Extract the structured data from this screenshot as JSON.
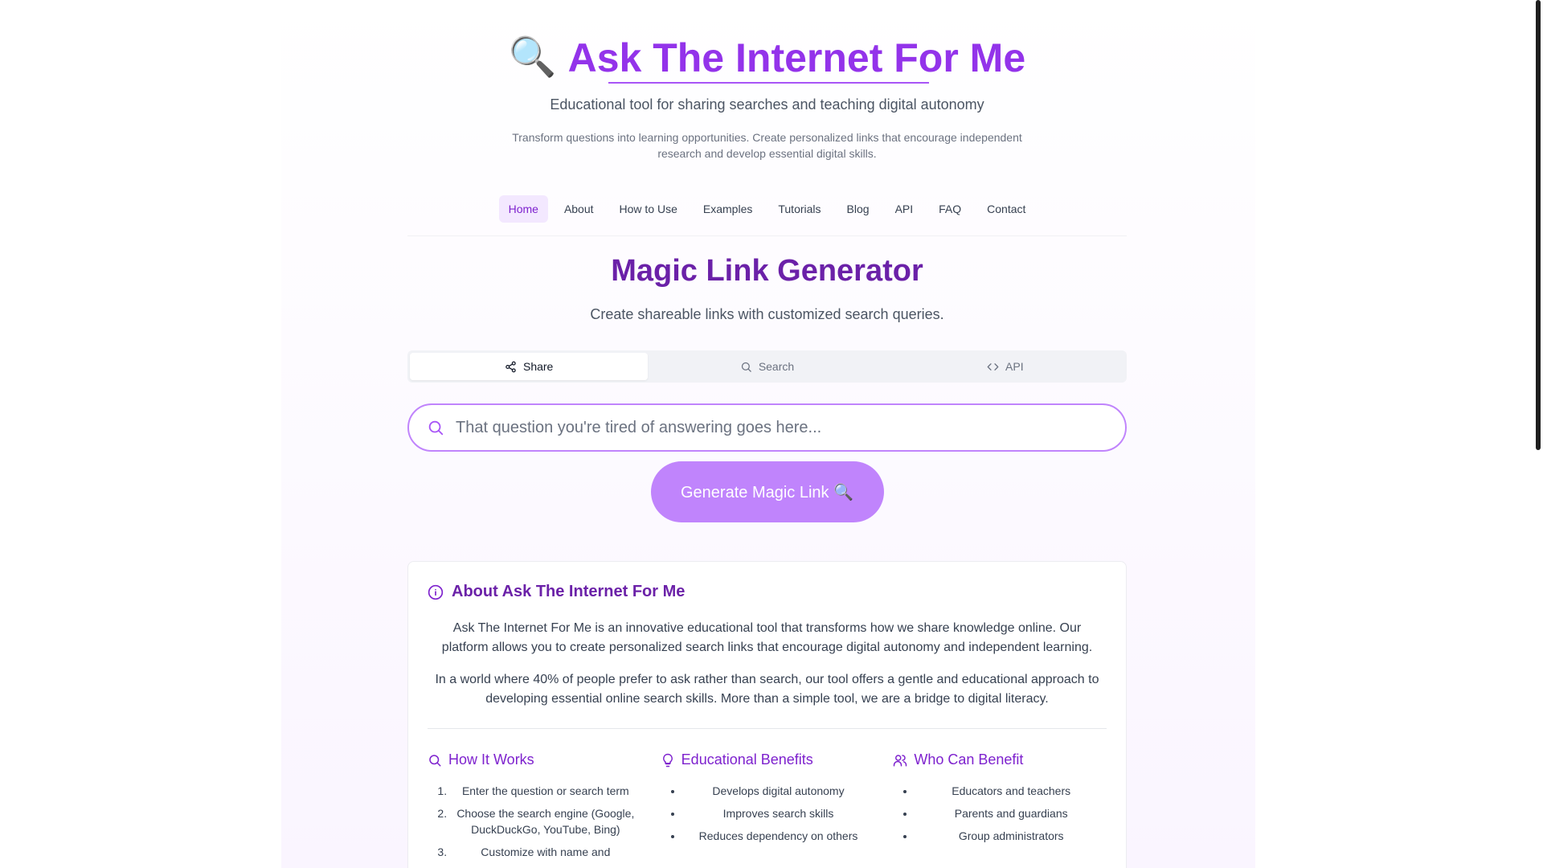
{
  "header": {
    "title": "Ask The Internet For Me",
    "tagline": "Educational tool for sharing searches and teaching digital autonomy",
    "description": "Transform questions into learning opportunities. Create personalized links that encourage independent research and develop essential digital skills."
  },
  "nav": {
    "items": [
      {
        "label": "Home",
        "active": true
      },
      {
        "label": "About"
      },
      {
        "label": "How to Use"
      },
      {
        "label": "Examples"
      },
      {
        "label": "Tutorials"
      },
      {
        "label": "Blog"
      },
      {
        "label": "API"
      },
      {
        "label": "FAQ"
      },
      {
        "label": "Contact"
      }
    ]
  },
  "generator": {
    "title": "Magic Link Generator",
    "subtitle": "Create shareable links with customized search queries.",
    "tabs": [
      {
        "label": "Share",
        "icon": "share-icon",
        "active": true
      },
      {
        "label": "Search",
        "icon": "search-icon"
      },
      {
        "label": "API",
        "icon": "code-icon"
      }
    ],
    "search_placeholder": "That question you're tired of answering goes here...",
    "search_value": "",
    "button_label": "Generate Magic Link 🔍"
  },
  "about": {
    "title": "About Ask The Internet For Me",
    "paragraphs": [
      "Ask The Internet For Me is an innovative educational tool that transforms how we share knowledge online. Our platform allows you to create personalized search links that encourage digital autonomy and independent learning.",
      "In a world where 40% of people prefer to ask rather than search, our tool offers a gentle and educational approach to developing essential online search skills. More than a simple tool, we are a bridge to digital literacy."
    ],
    "columns": [
      {
        "title": "How It Works",
        "icon": "search-icon",
        "items": [
          "Enter the question or search term",
          "Choose the search engine (Google, DuckDuckGo, YouTube, Bing)",
          "Customize with name and"
        ]
      },
      {
        "title": "Educational Benefits",
        "icon": "lightbulb-icon",
        "items": [
          "Develops digital autonomy",
          "Improves search skills",
          "Reduces dependency on others"
        ]
      },
      {
        "title": "Who Can Benefit",
        "icon": "users-icon",
        "items": [
          "Educators and teachers",
          "Parents and guardians",
          "Group administrators"
        ]
      }
    ]
  },
  "colors": {
    "accent": "#9333ea",
    "accent_dark": "#6b21a8",
    "button": "#c084fc",
    "active_nav_bg": "#f3e8ff"
  }
}
